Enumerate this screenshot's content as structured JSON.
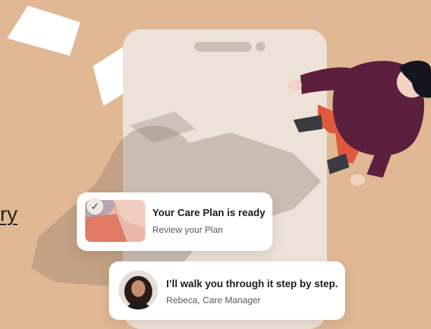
{
  "partial_link": {
    "text": "ry"
  },
  "plan_card": {
    "title": "Your Care Plan is ready",
    "subtitle": "Review your Plan",
    "check_icon": "check-icon"
  },
  "message_card": {
    "message": "I’ll walk you through it step by step.",
    "sender": "Rebeca, Care Manager"
  },
  "colors": {
    "background": "#e0b893",
    "phone": "#ede2d8",
    "person_top": "#5c1f3e",
    "person_pants": "#e0593e",
    "card": "#ffffff"
  }
}
